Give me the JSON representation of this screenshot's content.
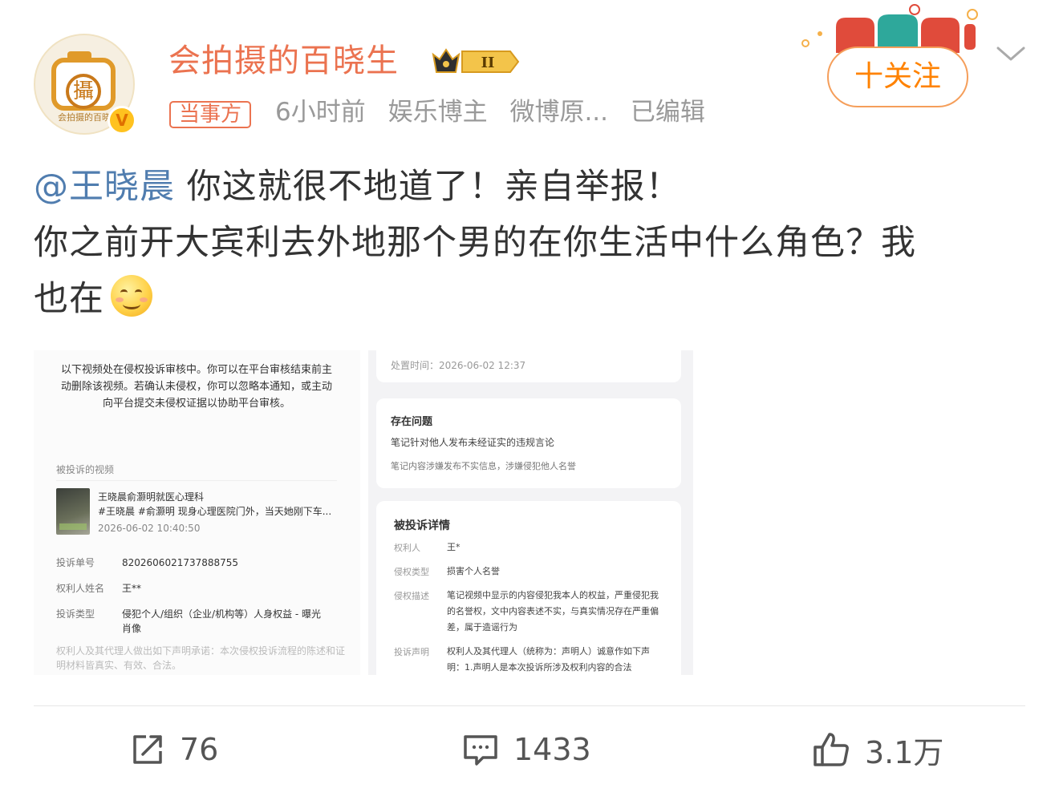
{
  "user": {
    "name": "会拍摄的百晓生",
    "avatar_caption": "会拍摄的百晓",
    "avatar_glyph": "攝",
    "verified_icon": "v-badge-icon",
    "level_badge": "II",
    "tag": "当事方",
    "time": "6小时前",
    "category": "娱乐博主",
    "source": "微博原...",
    "edited": "已编辑"
  },
  "header": {
    "follow_label": "十关注",
    "deco_icon": "festival-deco-icon",
    "more_icon": "chevron-down-icon"
  },
  "post": {
    "mention": "@王晓晨",
    "line1_rest": " 你这就很不地道了！亲自举报！",
    "line2": "你之前开大宾利去外地那个男的在你生活中什么角色？我",
    "line3": "也在",
    "emoji_icon": "smile-emoji-icon"
  },
  "image_left": {
    "notice": "以下视频处在侵权投诉审核中。你可以在平台审核结束前主动删除该视频。若确认未侵权，你可以忽略本通知，或主动向平台提交未侵权证据以协助平台审核。",
    "section_label": "被投诉的视频",
    "video_title": "王晓晨俞灏明就医心理科",
    "video_tags": "#王晓晨 #俞灏明 现身心理医院门外，当天她刚下车...",
    "video_time": "2026-06-02 10:40:50",
    "rows": [
      {
        "label": "投诉单号",
        "value": "8202606021737888755"
      },
      {
        "label": "权利人姓名",
        "value": "王**"
      },
      {
        "label": "投诉类型",
        "value": "侵犯个人/组织（企业/机构等）人身权益 - 曝光肖像"
      }
    ],
    "declaration": "权利人及其代理人做出如下声明承诺：本次侵权投诉流程的陈述和证明材料皆真实、有效、合法。"
  },
  "image_right": {
    "dispose_time": "处置时间：2026-06-02 12:37",
    "issue_heading": "存在问题",
    "issue_1": "笔记针对他人发布未经证实的违规言论",
    "issue_2": "笔记内容涉嫌发布不实信息，涉嫌侵犯他人名誉",
    "detail_heading": "被投诉详情",
    "details": [
      {
        "label": "权利人",
        "value": "王*"
      },
      {
        "label": "侵权类型",
        "value": "损害个人名誉"
      },
      {
        "label": "侵权描述",
        "value": "笔记视频中显示的内容侵犯我本人的权益，严重侵犯我的名誉权，文中内容表述不实，与真实情况存在严重偏差，属于造谣行为"
      },
      {
        "label": "投诉声明",
        "value": "权利人及其代理人（统称为：声明人）诚意作如下声明：1.声明人是本次投诉所涉及权利内容的合法"
      }
    ]
  },
  "actions": {
    "share_count": "76",
    "comment_count": "1433",
    "like_count": "3.1万",
    "share_icon": "share-icon",
    "comment_icon": "comment-icon",
    "like_icon": "thumbs-up-icon"
  },
  "colors": {
    "username": "#eb7350",
    "mention": "#507daf",
    "follow": "#ff8200"
  }
}
